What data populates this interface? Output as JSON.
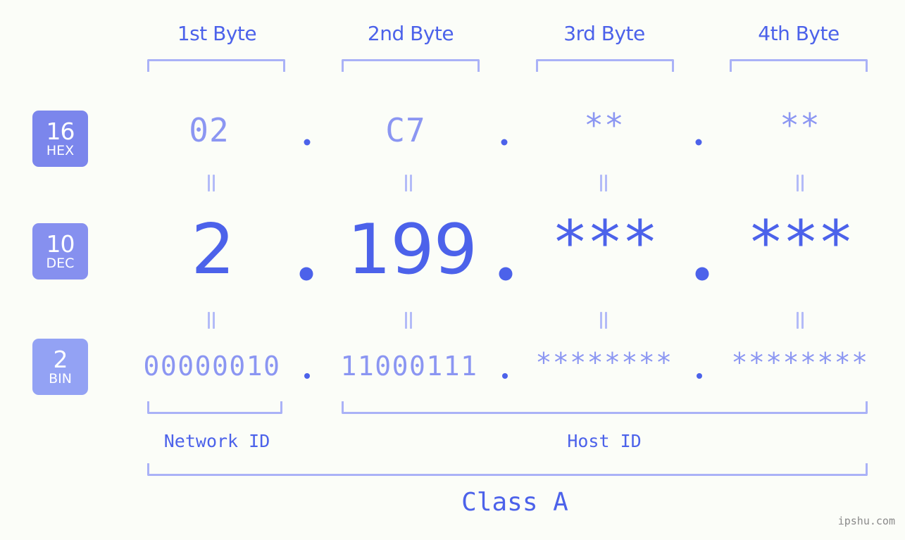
{
  "page": {
    "background_color": "#fbfdf8",
    "accent_color": "#4c62ea",
    "muted_color": "#8b96f2",
    "bracket_color": "#aab2f7",
    "watermark": "ipshu.com"
  },
  "byte_headers": [
    {
      "label": "1st Byte"
    },
    {
      "label": "2nd Byte"
    },
    {
      "label": "3rd Byte"
    },
    {
      "label": "4th Byte"
    }
  ],
  "bases": [
    {
      "num": "16",
      "sys": "HEX",
      "color": "#7b86ec"
    },
    {
      "num": "10",
      "sys": "DEC",
      "color": "#8690ef"
    },
    {
      "num": "2",
      "sys": "BIN",
      "color": "#93a2f4"
    }
  ],
  "rows": {
    "hex": {
      "values": [
        "02",
        "C7",
        "**",
        "**"
      ]
    },
    "dec": {
      "values": [
        "2",
        "199",
        "***",
        "***"
      ]
    },
    "bin": {
      "values": [
        "00000010",
        "11000111",
        "********",
        "********"
      ]
    }
  },
  "separators": {
    "hex": ".",
    "dec": ".",
    "bin": "."
  },
  "equality_marker": "||",
  "id_sections": [
    {
      "label": "Network ID"
    },
    {
      "label": "Host ID"
    }
  ],
  "class": {
    "label": "Class A"
  }
}
